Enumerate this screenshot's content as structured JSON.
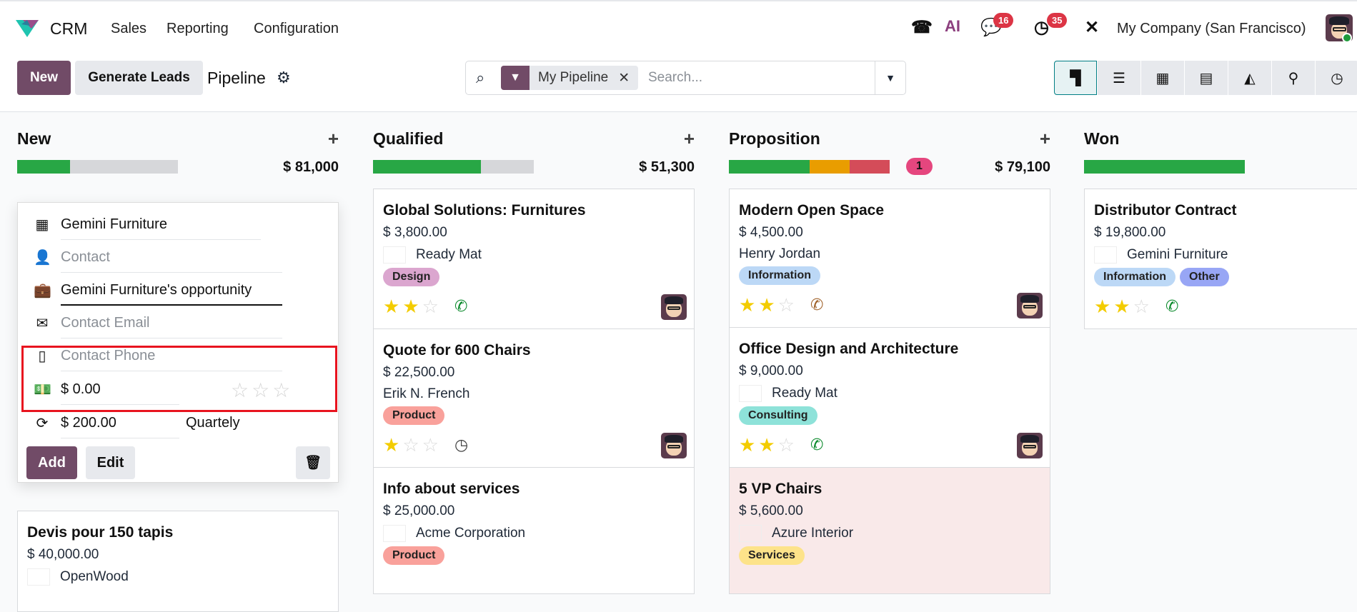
{
  "navbar": {
    "app": "CRM",
    "menus": [
      "Sales",
      "Reporting",
      "Configuration"
    ],
    "chat_badge": "16",
    "activity_badge": "35",
    "company": "My Company (San Francisco)",
    "ai_label": "AI"
  },
  "control": {
    "new_label": "New",
    "generate_label": "Generate Leads",
    "title": "Pipeline",
    "facet": "My Pipeline",
    "search_placeholder": "Search..."
  },
  "views": [
    "kanban",
    "list",
    "calendar",
    "pivot",
    "graph",
    "map",
    "activity"
  ],
  "quick_create": {
    "company": "Gemini Furniture",
    "contact_placeholder": "Contact",
    "opportunity": "Gemini Furniture's opportunity",
    "email_placeholder": "Contact Email",
    "phone_placeholder": "Contact Phone",
    "expected_revenue": "$ 0.00",
    "recurring_revenue": "$ 200.00",
    "recurring_plan": "Quartely",
    "priority": 0,
    "add_label": "Add",
    "edit_label": "Edit"
  },
  "colors": {
    "primary": "#714b67",
    "success": "#28a745",
    "warning": "#e99d00",
    "danger": "#d44c59"
  },
  "columns": [
    {
      "title": "New",
      "total": "$ 81,000",
      "progress": [
        {
          "color": "#28a745",
          "frac": 0.33
        }
      ],
      "cards": [
        {
          "name": "Devis pour 150 tapis",
          "amount": "$ 40,000.00",
          "customer": "OpenWood",
          "logo": "OpenWood",
          "tags": [],
          "stars": 0
        }
      ]
    },
    {
      "title": "Qualified",
      "total": "$ 51,300",
      "progress": [
        {
          "color": "#28a745",
          "frac": 0.67
        }
      ],
      "cards": [
        {
          "name": "Global Solutions: Furnitures",
          "amount": "$ 3,800.00",
          "customer": "Ready Mat",
          "logo": "READY MAT",
          "tags": [
            {
              "label": "Design",
              "color": "#dba6cf"
            }
          ],
          "stars": 2,
          "activity": "phone",
          "activity_color": "#0b8a2c",
          "avatar": true
        },
        {
          "name": "Quote for 600 Chairs",
          "amount": "$ 22,500.00",
          "customer": "Erik N. French",
          "tags": [
            {
              "label": "Product",
              "color": "#f9a19b"
            }
          ],
          "stars": 1,
          "activity": "clock",
          "activity_color": "#444",
          "avatar": true
        },
        {
          "name": "Info about services",
          "amount": "$ 25,000.00",
          "customer": "Acme Corporation",
          "logo": "ACME",
          "tags": [
            {
              "label": "Product",
              "color": "#f9a19b"
            }
          ],
          "stars": 0
        }
      ]
    },
    {
      "title": "Proposition",
      "total": "$ 79,100",
      "count": "1",
      "progress": [
        {
          "color": "#28a745",
          "frac": 0.5
        },
        {
          "color": "#e99d00",
          "frac": 0.25
        },
        {
          "color": "#d44c59",
          "frac": 0.25
        }
      ],
      "cards": [
        {
          "name": "Modern Open Space",
          "amount": "$ 4,500.00",
          "customer": "Henry Jordan",
          "tags": [
            {
              "label": "Information",
              "color": "#bcd8f6"
            }
          ],
          "stars": 2,
          "activity": "phone",
          "activity_color": "#a0622a",
          "avatar": true
        },
        {
          "name": "Office Design and Architecture",
          "amount": "$ 9,000.00",
          "customer": "Ready Mat",
          "logo": "READY MAT",
          "tags": [
            {
              "label": "Consulting",
              "color": "#8ee2d9"
            }
          ],
          "stars": 2,
          "activity": "phone",
          "activity_color": "#0b8a2c",
          "avatar": true
        },
        {
          "name": "5 VP Chairs",
          "amount": "$ 5,600.00",
          "customer": "Azure Interior",
          "logo": "azure",
          "tags": [
            {
              "label": "Services",
              "color": "#fde38a"
            }
          ],
          "stars": 0,
          "danger": true
        }
      ]
    },
    {
      "title": "Won",
      "total": "$",
      "progress": [
        {
          "color": "#28a745",
          "frac": 1
        }
      ],
      "cards": [
        {
          "name": "Distributor Contract",
          "amount": "$ 19,800.00",
          "customer": "Gemini Furniture",
          "logo": "Gemini",
          "tags": [
            {
              "label": "Information",
              "color": "#bcd8f6"
            },
            {
              "label": "Other",
              "color": "#98a6f5"
            }
          ],
          "stars": 2,
          "activity": "phone",
          "activity_color": "#0b8a2c"
        }
      ]
    }
  ]
}
